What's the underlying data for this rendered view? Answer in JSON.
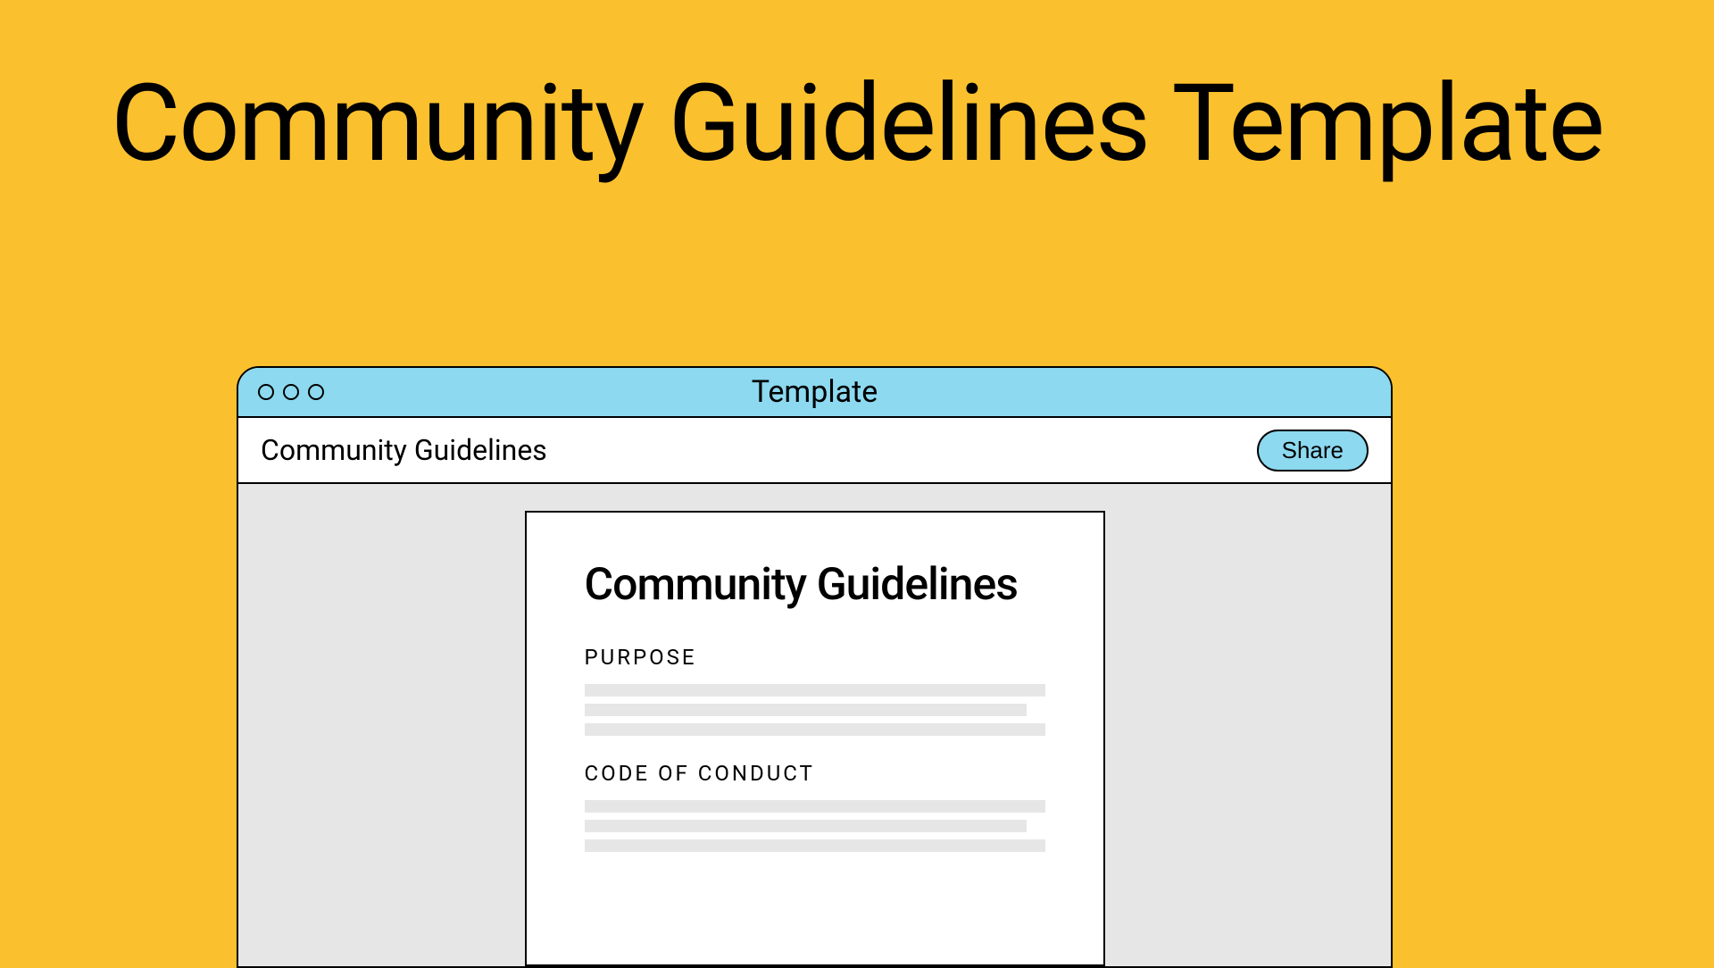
{
  "page_title": "Community Guidelines Template",
  "window": {
    "titlebar_label": "Template",
    "toolbar": {
      "title": "Community Guidelines",
      "share_label": "Share"
    }
  },
  "document": {
    "heading": "Community Guidelines",
    "sections": [
      {
        "label": "PURPOSE"
      },
      {
        "label": "CODE OF CONDUCT"
      }
    ]
  }
}
